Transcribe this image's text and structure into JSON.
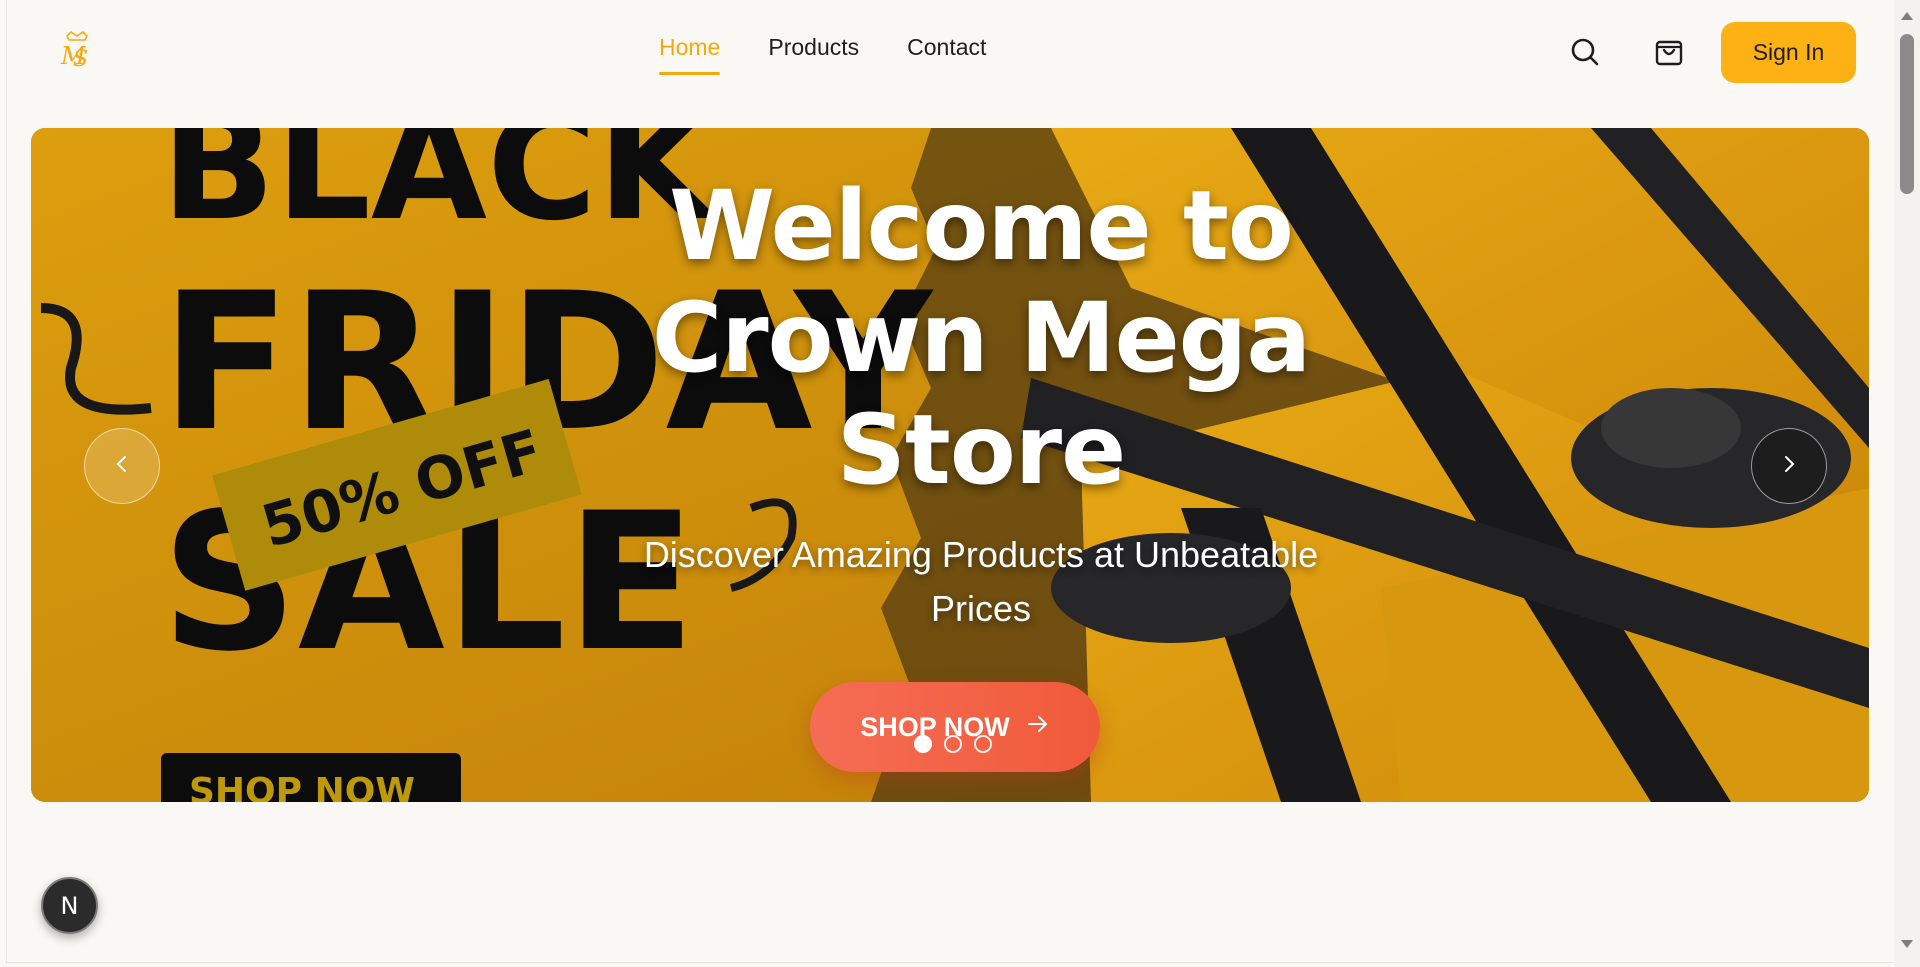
{
  "header": {
    "logo_icon": "crown-monogram-logo",
    "nav": [
      {
        "label": "Home",
        "active": true
      },
      {
        "label": "Products",
        "active": false
      },
      {
        "label": "Contact",
        "active": false
      }
    ],
    "search_icon": "search-icon",
    "cart_icon": "shopping-bag-icon",
    "signin_label": "Sign In",
    "accent_color": "#f5a90f"
  },
  "hero": {
    "title": "Welcome to Crown Mega Store",
    "subtitle": "Discover Amazing Products at Unbeatable Prices",
    "cta_label": "SHOP NOW",
    "cta_icon": "arrow-right-icon",
    "prev_icon": "chevron-left-icon",
    "next_icon": "chevron-right-icon",
    "slides_count": 3,
    "active_slide": 1,
    "banner_image": {
      "line1": "BLACK",
      "line2": "FRIDAY",
      "line3": "SALE",
      "tag": "50% OFF",
      "button": "SHOP NOW"
    },
    "cta_color": "#f05a3a"
  },
  "badge": {
    "label": "N"
  }
}
